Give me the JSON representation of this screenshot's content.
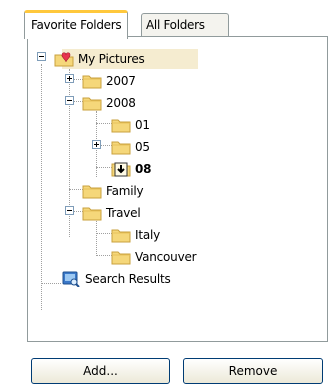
{
  "tabs": [
    {
      "label": "Favorite Folders",
      "active": true
    },
    {
      "label": "All Folders",
      "active": false
    }
  ],
  "tree": {
    "root": {
      "label": "My Pictures",
      "icon": "heart-folder-icon"
    },
    "items": [
      {
        "label": "2007",
        "expander": "plus",
        "icon": "folder-icon"
      },
      {
        "label": "2008",
        "expander": "minus",
        "icon": "folder-icon"
      },
      {
        "label": "01",
        "icon": "folder-icon"
      },
      {
        "label": "05",
        "expander": "plus",
        "icon": "folder-icon"
      },
      {
        "label": "08",
        "icon": "import-folder-icon",
        "bold": true
      },
      {
        "label": "Family",
        "icon": "folder-icon"
      },
      {
        "label": "Travel",
        "expander": "minus",
        "icon": "folder-icon"
      },
      {
        "label": "Italy",
        "icon": "folder-icon"
      },
      {
        "label": "Vancouver",
        "icon": "folder-icon"
      },
      {
        "label": "Search Results",
        "icon": "search-results-icon"
      }
    ]
  },
  "buttons": {
    "add": "Add...",
    "remove": "Remove"
  },
  "colors": {
    "folder": "#f5d77a",
    "folder_edge": "#c9a13e",
    "selection": "#f5ecd0",
    "tab_accent": "#ffc83c",
    "border": "#919b9c"
  }
}
